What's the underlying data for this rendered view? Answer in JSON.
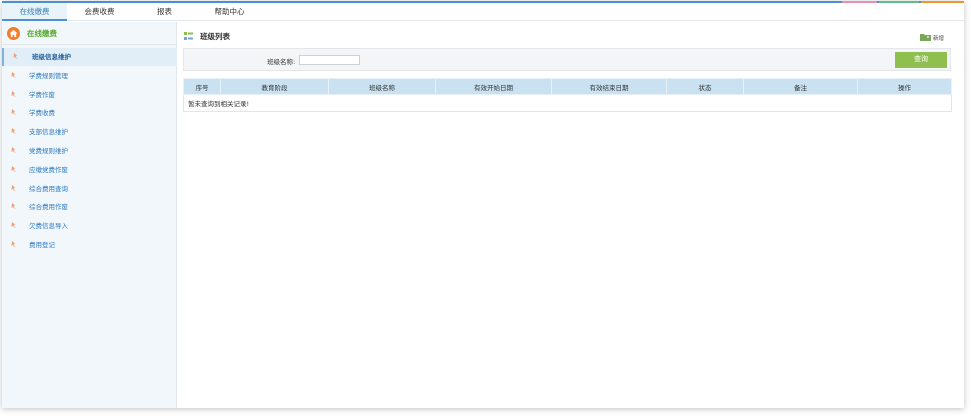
{
  "topnav": {
    "tabs": [
      {
        "label": "在线缴费",
        "active": true
      },
      {
        "label": "会费收费",
        "active": false
      },
      {
        "label": "报表",
        "active": false
      },
      {
        "label": "帮助中心",
        "active": false
      }
    ]
  },
  "sidebar": {
    "title": "在线缴费",
    "title_icon": "home-icon",
    "items": [
      {
        "label": "班级信息维护",
        "active": true
      },
      {
        "label": "学费规则管理",
        "active": false
      },
      {
        "label": "学费作废",
        "active": false
      },
      {
        "label": "学费收费",
        "active": false
      },
      {
        "label": "支部信息维护",
        "active": false
      },
      {
        "label": "党费规则维护",
        "active": false
      },
      {
        "label": "应缴党费作废",
        "active": false
      },
      {
        "label": "综合费用查询",
        "active": false
      },
      {
        "label": "综合费用作废",
        "active": false
      },
      {
        "label": "欠费信息导入",
        "active": false
      },
      {
        "label": "费用登记",
        "active": false
      }
    ]
  },
  "main": {
    "title": "班级列表",
    "add_label": "新增",
    "search": {
      "label": "班级名称:",
      "value": "",
      "placeholder": "",
      "button_label": "查询"
    },
    "table": {
      "columns": [
        "序号",
        "教育阶段",
        "班级名称",
        "有效开始日期",
        "有效结束日期",
        "状态",
        "备注",
        "操作"
      ],
      "empty_message": "暂未查询到相关记录!"
    }
  },
  "colors": {
    "accent_blue": "#4a8fd4",
    "accent_green": "#8fbf4e",
    "home_orange": "#ef7d2c",
    "header_bg": "#c9e1f0"
  }
}
